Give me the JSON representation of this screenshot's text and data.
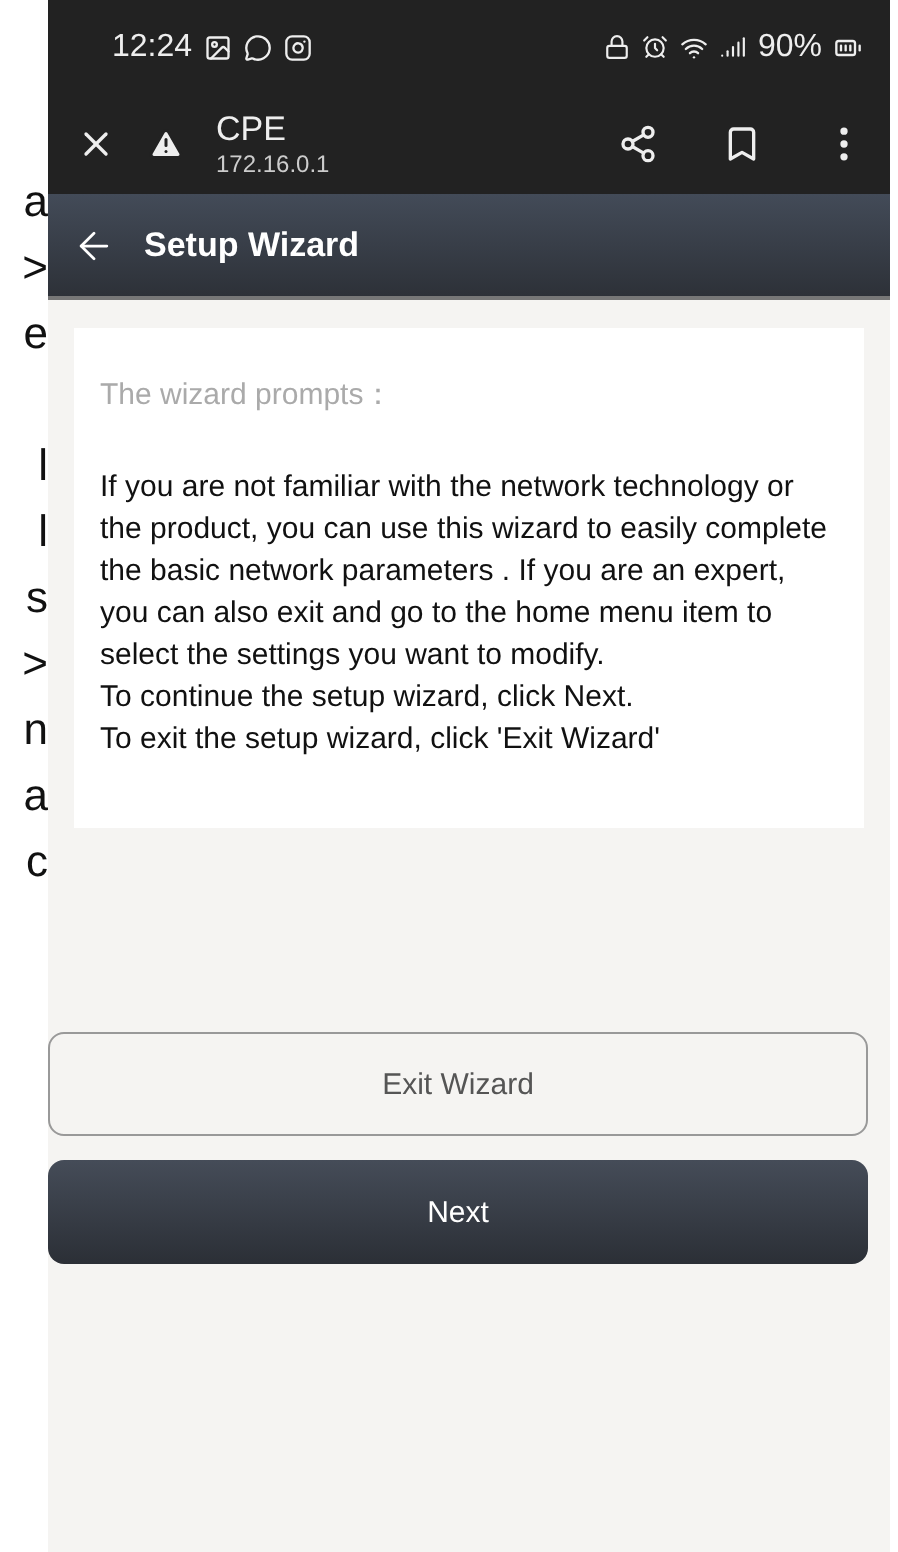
{
  "margin_fragments": [
    {
      "text": "a"
    },
    {
      "text": ">"
    },
    {
      "text": "e"
    },
    {
      "text": "l"
    },
    {
      "text": "l"
    },
    {
      "text": "s"
    },
    {
      "text": ">"
    },
    {
      "text": "n"
    },
    {
      "text": "a"
    },
    {
      "text": "c"
    }
  ],
  "status_bar": {
    "time": "12:24",
    "battery": "90%"
  },
  "browser_bar": {
    "title": "CPE",
    "url": "172.16.0.1"
  },
  "header": {
    "title": "Setup Wizard"
  },
  "card": {
    "heading": "The wizard prompts：",
    "paragraphs": [
      "If you are not familiar with the network technology or the product, you can use this wizard to easily complete the basic network parameters . If you are an expert, you can also exit and go to the home menu item to select the settings you want to modify.",
      "To continue the setup wizard, click Next.",
      "To exit the setup wizard, click 'Exit Wizard'"
    ]
  },
  "buttons": [
    {
      "label": "Exit Wizard",
      "kind": "secondary"
    },
    {
      "label": "Next",
      "kind": "primary"
    }
  ]
}
